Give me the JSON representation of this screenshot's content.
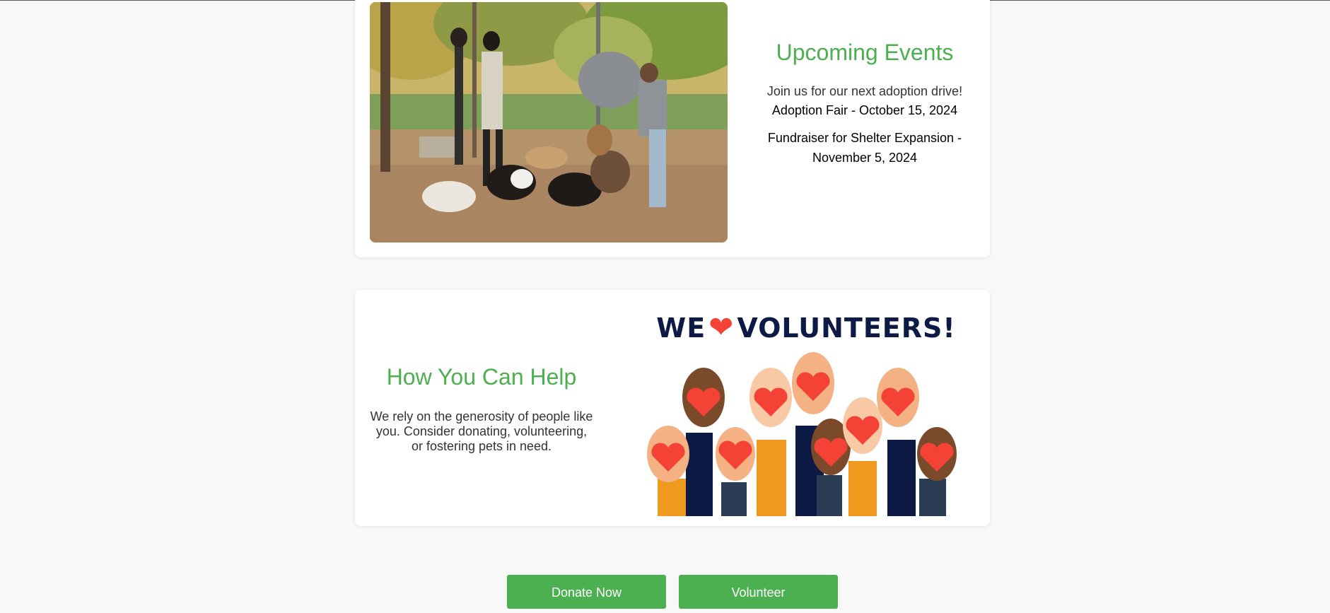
{
  "events": {
    "title": "Upcoming Events",
    "intro": "Join us for our next adoption drive!",
    "items": [
      "Adoption Fair - October 15, 2024",
      "Fundraiser for Shelter Expansion - November 5, 2024"
    ],
    "image_alt": "People with dogs at a park"
  },
  "help": {
    "title": "How You Can Help",
    "body": "We rely on the generosity of people like you. Consider donating, volunteering, or fostering pets in need.",
    "image_heading_left": "WE",
    "image_heading_right": "VOLUNTEERS!",
    "heart_icon": "heart-icon"
  },
  "buttons": {
    "donate": "Donate Now",
    "volunteer": "Volunteer"
  },
  "colors": {
    "accent": "#4caf50",
    "heart": "#f44336",
    "navy": "#0d1a45"
  }
}
